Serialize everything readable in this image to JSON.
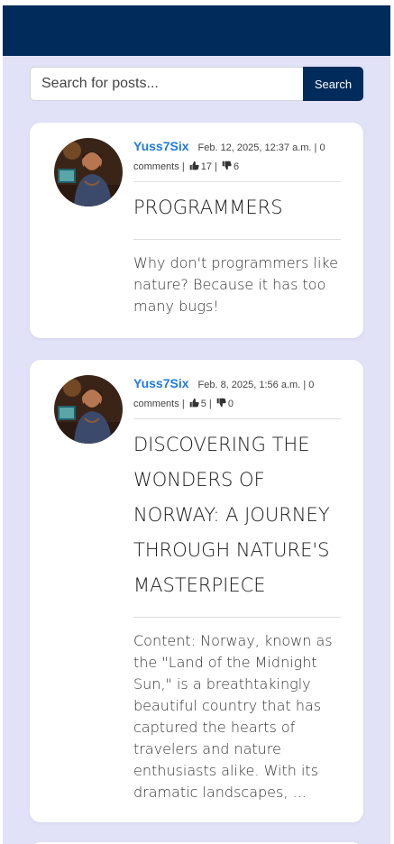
{
  "search": {
    "placeholder": "Search for posts...",
    "button_label": "Search"
  },
  "posts": [
    {
      "author": "Yuss7Six",
      "date": "Feb. 12, 2025, 12:37 a.m.",
      "sep1": "|",
      "comments": "0 comments",
      "sep2": "|",
      "likes": "17",
      "sep3": "|",
      "dislikes": "6",
      "title": "PROGRAMMERS",
      "excerpt": "Why don't programmers like nature? Because it has too many bugs!",
      "like_icon": "thumbs-up-icon",
      "dislike_icon": "thumbs-down-icon"
    },
    {
      "author": "Yuss7Six",
      "date": "Feb. 8, 2025, 1:56 a.m.",
      "sep1": "|",
      "comments": "0 comments",
      "sep2": "|",
      "likes": "5",
      "sep3": "|",
      "dislikes": "0",
      "title": "DISCOVERING THE WONDERS OF NORWAY: A JOURNEY THROUGH NATURE'S MASTERPIECE",
      "excerpt": "Content: Norway, known as the \"Land of the Midnight Sun,\" is a breathtakingly beautiful country that has captured the hearts of travelers and nature enthusiasts alike. With its dramatic landscapes, ...",
      "like_icon": "thumbs-up-icon",
      "dislike_icon": "thumbs-down-icon"
    }
  ],
  "colors": {
    "navbar": "#002b5b",
    "background": "#e1e1f7",
    "author_link": "#1f7ae0",
    "card": "#ffffff"
  }
}
